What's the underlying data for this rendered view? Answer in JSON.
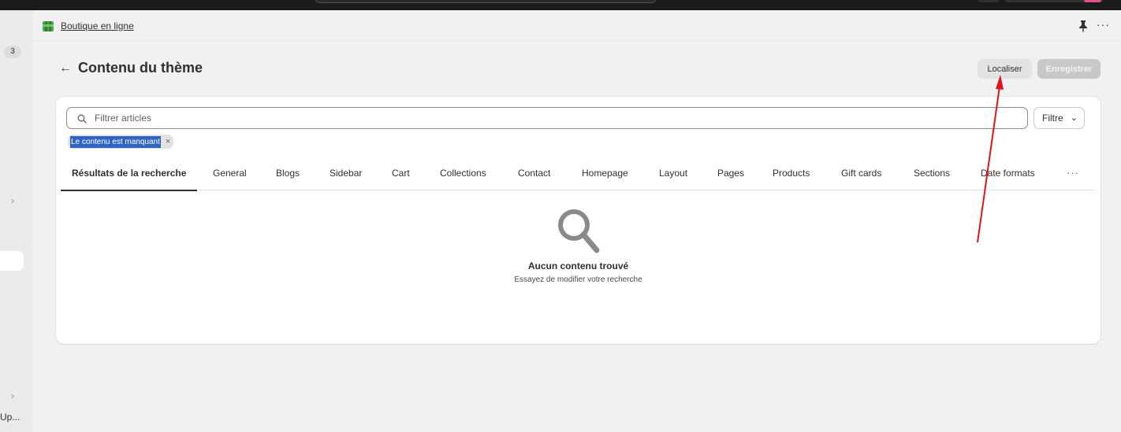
{
  "app": {
    "name": "Boutique en ligne"
  },
  "sidebar": {
    "badge": "3",
    "bottom_label": "Up..."
  },
  "page": {
    "title": "Contenu du thème",
    "localize_label": "Localiser",
    "save_label": "Enregistrer"
  },
  "search": {
    "placeholder": "Filtrer articles",
    "value": "",
    "filter_label": "Filtre"
  },
  "active_filter": {
    "label": "Le contenu est manquant"
  },
  "tabs": [
    {
      "label": "Résultats de la recherche",
      "active": true
    },
    {
      "label": "General"
    },
    {
      "label": "Blogs"
    },
    {
      "label": "Sidebar"
    },
    {
      "label": "Cart"
    },
    {
      "label": "Collections"
    },
    {
      "label": "Contact"
    },
    {
      "label": "Homepage"
    },
    {
      "label": "Layout"
    },
    {
      "label": "Pages"
    },
    {
      "label": "Products"
    },
    {
      "label": "Gift cards"
    },
    {
      "label": "Sections"
    },
    {
      "label": "Date formats"
    }
  ],
  "empty_state": {
    "title": "Aucun contenu trouvé",
    "subtitle": "Essayez de modifier votre recherche"
  },
  "colors": {
    "accent": "#303030",
    "selection": "#2f64c5",
    "annotation_arrow": "#e0151b"
  },
  "icons": {
    "app_logo": "shopify-bag-icon",
    "pin": "pin-icon",
    "more": "more-horizontal-icon",
    "back": "arrow-left-icon",
    "search": "search-icon",
    "dropdown": "chevron-down-icon",
    "chip_remove": "close-icon",
    "empty": "magnifier-icon"
  }
}
